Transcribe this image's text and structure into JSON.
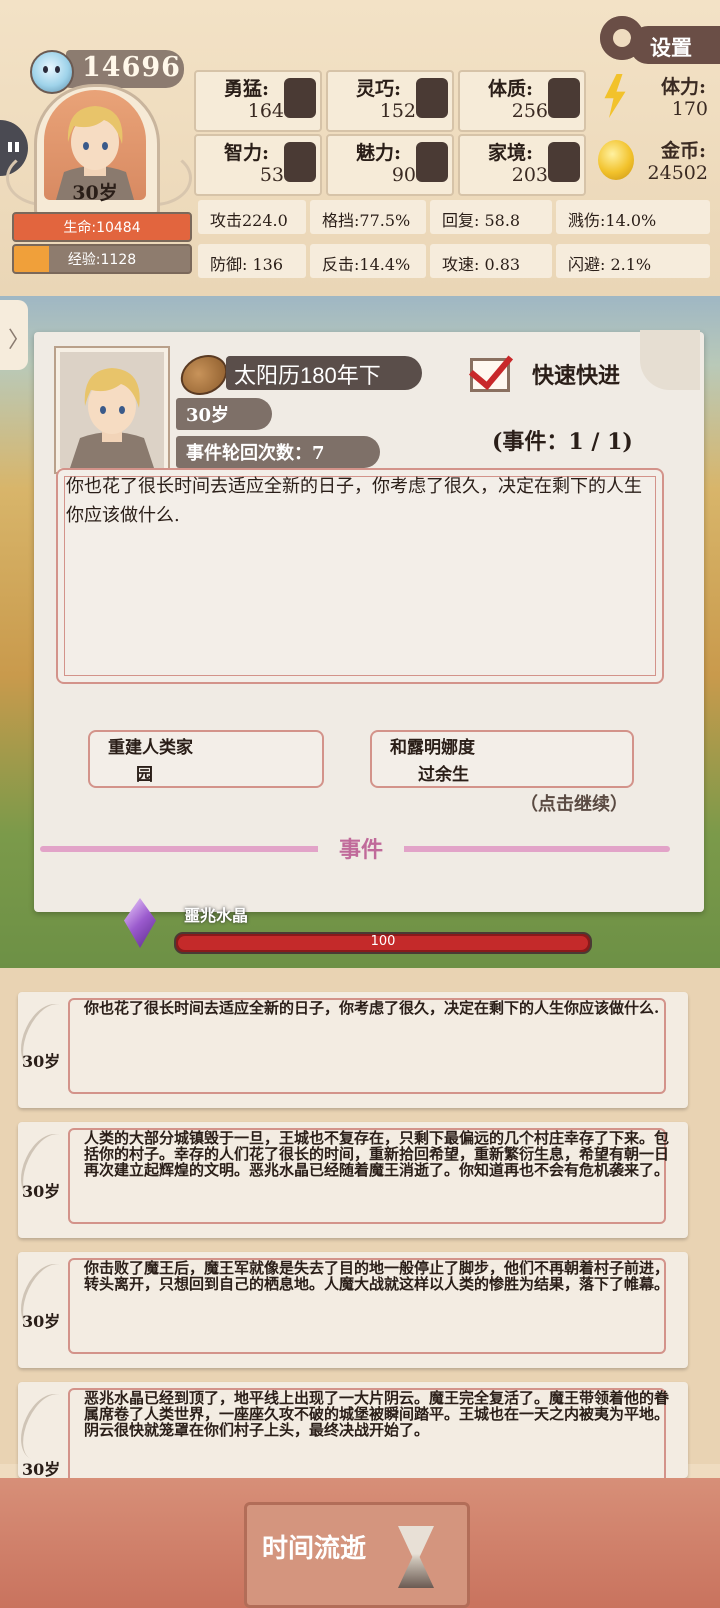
{
  "header": {
    "score": "14696",
    "age": "30岁",
    "settings_label": "设置",
    "life": "生命:10484",
    "exp": "经验:1128",
    "life_fraction": 1.0,
    "exp_fraction": 0.2
  },
  "stats": [
    {
      "label": "勇猛:",
      "value": "164",
      "icon": "fist-icon"
    },
    {
      "label": "灵巧:",
      "value": "152",
      "icon": "hand-icon"
    },
    {
      "label": "体质:",
      "value": "256",
      "icon": "muscle-icon"
    },
    {
      "label": "智力:",
      "value": "53",
      "icon": "brain-icon"
    },
    {
      "label": "魅力:",
      "value": "90",
      "icon": "flower-icon"
    },
    {
      "label": "家境:",
      "value": "203",
      "icon": "bag-icon"
    }
  ],
  "stamina": {
    "label": "体力:",
    "value": "170"
  },
  "gold": {
    "label": "金币:",
    "value": "24502"
  },
  "combat": [
    "攻击224.0",
    "格挡:77.5%",
    "回复:  58.8",
    "溅伤:14.0%",
    "防御:  136",
    "反击:14.4%",
    "攻速:  0.83",
    "闪避:  2.1%"
  ],
  "event": {
    "date": "太阳历180年下",
    "fast_forward": "快速快进",
    "age": "30岁",
    "cycles": "事件轮回次数：7",
    "count": "(事件：1 / 1)",
    "text": "你也花了很长时间去适应全新的日子，你考虑了很久，决定在剩下的人生你应该做什么.",
    "choice1_line1": "重建人类家",
    "choice1_line2": "园",
    "choice2_line1": "和露明娜度",
    "choice2_line2": "过余生",
    "continue": "（点击继续）",
    "section_label": "事件"
  },
  "crystal": {
    "name": "噩兆水晶",
    "value": "100",
    "fraction": 1.0
  },
  "log": [
    {
      "age": "30岁",
      "text": "你也花了很长时间去适应全新的日子，你考虑了很久，决定在剩下的人生你应该做什么."
    },
    {
      "age": "30岁",
      "text": "人类的大部分城镇毁于一旦，王城也不复存在，只剩下最偏远的几个村庄幸存了下来。包括你的村子。幸存的人们花了很长的时间，重新拾回希望，重新繁衍生息，希望有朝一日再次建立起辉煌的文明。恶兆水晶已经随着魔王消逝了。你知道再也不会有危机袭来了。"
    },
    {
      "age": "30岁",
      "text": "你击败了魔王后，魔王军就像是失去了目的地一般停止了脚步，他们不再朝着村子前进，转头离开，只想回到自己的栖息地。人魔大战就这样以人类的惨胜为结果，落下了帷幕。"
    },
    {
      "age": "30岁",
      "text": "恶兆水晶已经到顶了，地平线上出现了一大片阴云。魔王完全复活了。魔王带领着他的眷属席卷了人类世界，一座座久攻不破的城堡被瞬间踏平。王城也在一天之内被夷为平地。阴云很快就笼罩在你们村子上头，最终决战开始了。"
    }
  ],
  "bottom": {
    "time_button": "时间流逝"
  }
}
